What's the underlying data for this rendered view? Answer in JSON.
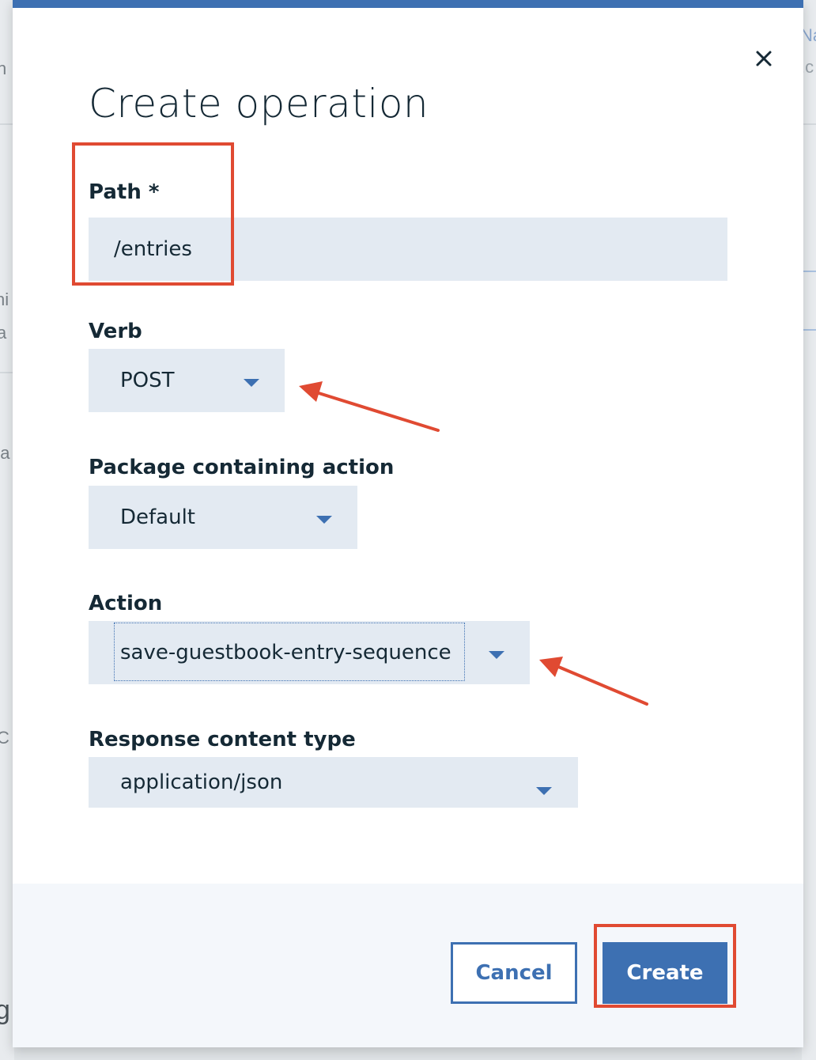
{
  "background": {
    "fragments": [
      "n",
      "ni",
      "a",
      "oa",
      "C",
      "g",
      "Na",
      ".c"
    ]
  },
  "modal": {
    "title": "Create operation",
    "close_icon": "close-icon",
    "fields": {
      "path": {
        "label": "Path *",
        "value": "/entries"
      },
      "verb": {
        "label": "Verb",
        "value": "POST"
      },
      "package": {
        "label": "Package containing action",
        "value": "Default"
      },
      "action": {
        "label": "Action",
        "value": "save-guestbook-entry-sequence"
      },
      "response_type": {
        "label": "Response content type",
        "value": "application/json"
      }
    },
    "footer": {
      "cancel_label": "Cancel",
      "create_label": "Create"
    }
  },
  "colors": {
    "accent": "#3d70b2",
    "input_bg": "#e3eaf2",
    "annotation": "#e04a32",
    "text": "#152935"
  }
}
